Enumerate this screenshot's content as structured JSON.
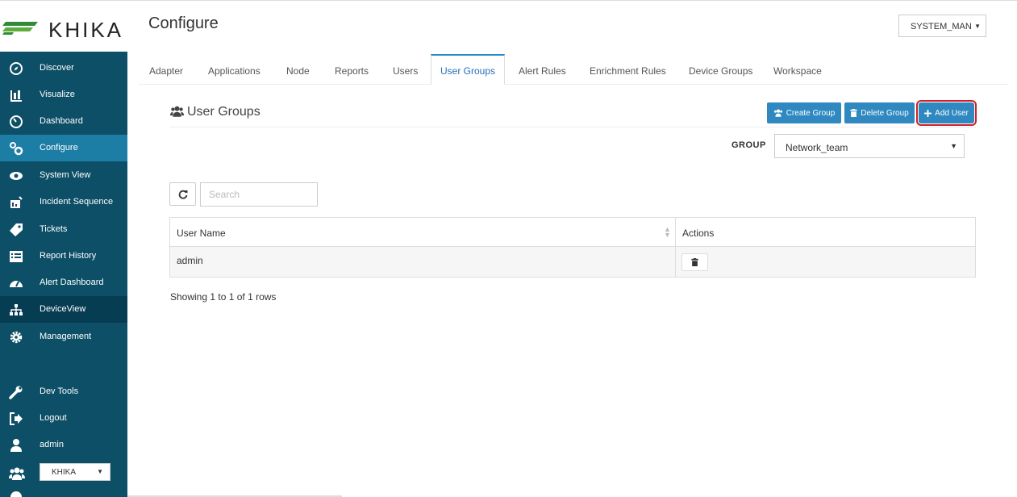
{
  "brand": {
    "name": "KHIKA"
  },
  "header": {
    "title": "Configure",
    "user_menu": "SYSTEM_MAN"
  },
  "sidebar": {
    "items": [
      {
        "label": "Discover",
        "icon": "compass-icon"
      },
      {
        "label": "Visualize",
        "icon": "bar-chart-icon"
      },
      {
        "label": "Dashboard",
        "icon": "dashboard-icon"
      },
      {
        "label": "Configure",
        "icon": "cogs-icon",
        "active": true
      },
      {
        "label": "System View",
        "icon": "eye-icon"
      },
      {
        "label": "Incident Sequence",
        "icon": "incident-icon"
      },
      {
        "label": "Tickets",
        "icon": "tag-icon"
      },
      {
        "label": "Report History",
        "icon": "list-icon"
      },
      {
        "label": "Alert Dashboard",
        "icon": "tachometer-icon"
      },
      {
        "label": "DeviceView",
        "icon": "sitemap-icon"
      },
      {
        "label": "Management",
        "icon": "gear-icon"
      },
      {
        "label": "Dev Tools",
        "icon": "wrench-icon"
      },
      {
        "label": "Logout",
        "icon": "sign-out-icon"
      },
      {
        "label": "admin",
        "icon": "user-icon"
      }
    ],
    "org_select": "KHIKA"
  },
  "tabs": [
    "Adapter",
    "Applications",
    "Node",
    "Reports",
    "Users",
    "User Groups",
    "Alert Rules",
    "Enrichment Rules",
    "Device Groups",
    "Workspace"
  ],
  "active_tab": "User Groups",
  "section": {
    "title": "User Groups",
    "buttons": {
      "create": "Create Group",
      "delete": "Delete Group",
      "add_user": "Add User"
    }
  },
  "group": {
    "label": "GROUP",
    "selected": "Network_team"
  },
  "search": {
    "placeholder": "Search"
  },
  "table": {
    "columns": [
      "User Name",
      "Actions"
    ],
    "rows": [
      {
        "user_name": "admin"
      }
    ]
  },
  "pagination": {
    "text": "Showing 1 to 1 of 1 rows"
  },
  "colors": {
    "sidebar": "#0c4f67",
    "sidebar_active": "#1d7ea5",
    "primary_button": "#2f88c0",
    "highlight": "#d0202a"
  }
}
